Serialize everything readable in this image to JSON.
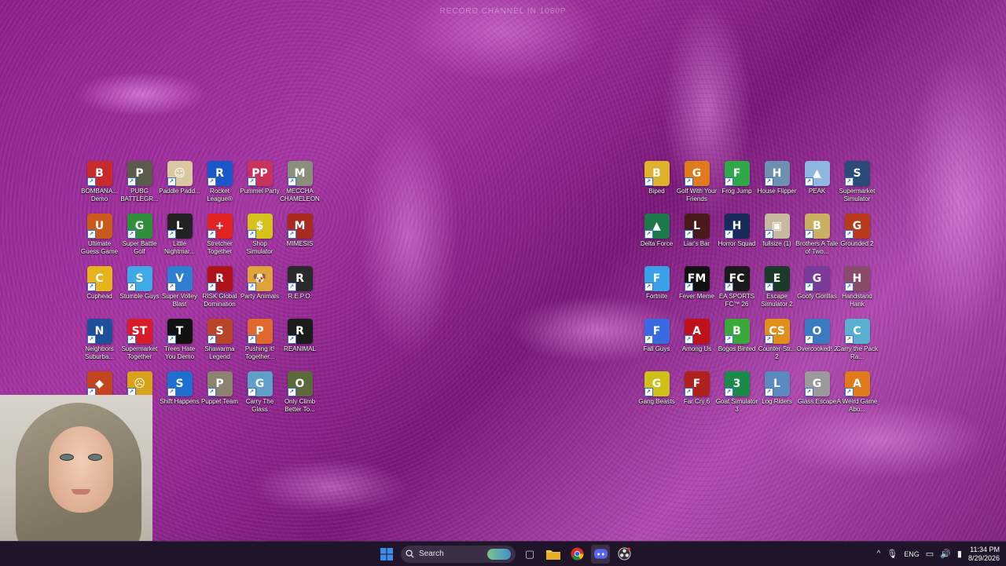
{
  "overlay_text": "RECORD CHANNEL IN 1080P",
  "left_icons": [
    {
      "label": "BOMBANA... Demo",
      "icon": "bombana-icon",
      "abbr": "B",
      "color": "#c92b2b"
    },
    {
      "label": "PUBG BATTLEGR...",
      "icon": "pubg-icon",
      "abbr": "P",
      "color": "#5b5b4a"
    },
    {
      "label": "Paddle Padd...",
      "icon": "paddle-paddle-icon",
      "abbr": "☺",
      "color": "#d9c8a0"
    },
    {
      "label": "Rocket League®",
      "icon": "rocket-league-icon",
      "abbr": "R",
      "color": "#1a58c9"
    },
    {
      "label": "Pummel Party",
      "icon": "pummel-party-icon",
      "abbr": "PP",
      "color": "#c9325a"
    },
    {
      "label": "MECCHA CHAMELEON",
      "icon": "meccha-chameleon-icon",
      "abbr": "M",
      "color": "#8a8f7c"
    },
    {
      "label": "Ultimate Guess Game",
      "icon": "ultimate-guess-game-icon",
      "abbr": "U",
      "color": "#c95a1b"
    },
    {
      "label": "Super Battle Golf",
      "icon": "super-battle-golf-icon",
      "abbr": "G",
      "color": "#2f8f3a"
    },
    {
      "label": "Little Nightmar...",
      "icon": "little-nightmares-icon",
      "abbr": "L",
      "color": "#222222"
    },
    {
      "label": "Stretcher Together",
      "icon": "stretcher-together-icon",
      "abbr": "+",
      "color": "#e02424"
    },
    {
      "label": "Shop Simulator",
      "icon": "shop-simulator-icon",
      "abbr": "$",
      "color": "#d6c21b"
    },
    {
      "label": "MIMESIS",
      "icon": "mimesis-icon",
      "abbr": "M",
      "color": "#a82a20"
    },
    {
      "label": "Cuphead",
      "icon": "cuphead-icon",
      "abbr": "C",
      "color": "#e8b21c"
    },
    {
      "label": "Stumble Guys",
      "icon": "stumble-guys-icon",
      "abbr": "S",
      "color": "#3fa9e8"
    },
    {
      "label": "Super Volley Blast",
      "icon": "super-volley-blast-icon",
      "abbr": "V",
      "color": "#2e7fd1"
    },
    {
      "label": "RISK Global Domination",
      "icon": "risk-icon",
      "abbr": "R",
      "color": "#b0121a"
    },
    {
      "label": "Party Animals",
      "icon": "party-animals-icon",
      "abbr": "🐶",
      "color": "#e0a33c"
    },
    {
      "label": "R.E.P.O.",
      "icon": "repo-icon",
      "abbr": "R",
      "color": "#2a2a2a"
    },
    {
      "label": "Neighbors Suburba...",
      "icon": "neighbors-icon",
      "abbr": "N",
      "color": "#1f4f9a"
    },
    {
      "label": "Supermarket Together",
      "icon": "supermarket-together-icon",
      "abbr": "ST",
      "color": "#d91c2c"
    },
    {
      "label": "Trees Hate You Demo",
      "icon": "trees-hate-you-icon",
      "abbr": "T",
      "color": "#111111"
    },
    {
      "label": "Shawarma Legend",
      "icon": "shawarma-legend-icon",
      "abbr": "S",
      "color": "#b8442a"
    },
    {
      "label": "Pushing it! Together...",
      "icon": "pushing-it-icon",
      "abbr": "P",
      "color": "#e0682f"
    },
    {
      "label": "REANIMAL",
      "icon": "reanimal-icon",
      "abbr": "R",
      "color": "#1b1b1b"
    },
    {
      "label": "",
      "icon": "game-icon",
      "abbr": "◆",
      "color": "#c2461d"
    },
    {
      "label": "",
      "icon": "game-icon",
      "abbr": "☹",
      "color": "#d8a21c"
    },
    {
      "label": "Shift Happens",
      "icon": "shift-happens-icon",
      "abbr": "S",
      "color": "#1f6fd0"
    },
    {
      "label": "Puppet Team",
      "icon": "puppet-team-icon",
      "abbr": "P",
      "color": "#8a8370"
    },
    {
      "label": "Carry The Glass",
      "icon": "carry-the-glass-icon",
      "abbr": "G",
      "color": "#5fa0c8"
    },
    {
      "label": "Only Climb Better To...",
      "icon": "only-climb-icon",
      "abbr": "O",
      "color": "#5c6a3a"
    }
  ],
  "right_icons": [
    {
      "label": "Biped",
      "icon": "biped-icon",
      "abbr": "B",
      "color": "#e0b12a"
    },
    {
      "label": "Golf With Your Friends",
      "icon": "golf-with-friends-icon",
      "abbr": "G",
      "color": "#e07b1c"
    },
    {
      "label": "Frog Jump",
      "icon": "frog-jump-icon",
      "abbr": "F",
      "color": "#2fa84a"
    },
    {
      "label": "House Flipper",
      "icon": "house-flipper-icon",
      "abbr": "H",
      "color": "#6d8fb0"
    },
    {
      "label": "PEAK",
      "icon": "peak-icon",
      "abbr": "▲",
      "color": "#8fb8e0"
    },
    {
      "label": "Supermarket Simulator",
      "icon": "supermarket-simulator-icon",
      "abbr": "S",
      "color": "#2a4a7a"
    },
    {
      "label": "Delta Force",
      "icon": "delta-force-icon",
      "abbr": "▲",
      "color": "#1c7a4a"
    },
    {
      "label": "Liar's Bar",
      "icon": "liars-bar-icon",
      "abbr": "L",
      "color": "#4a1a1a"
    },
    {
      "label": "Horror Squad",
      "icon": "horror-squad-icon",
      "abbr": "H",
      "color": "#1a2a5a"
    },
    {
      "label": "fullsize (1)",
      "icon": "image-file-icon",
      "abbr": "▣",
      "color": "#c8b8a0"
    },
    {
      "label": "Brothers A Tale of Two...",
      "icon": "brothers-icon",
      "abbr": "B",
      "color": "#c8b060"
    },
    {
      "label": "Grounded 2",
      "icon": "grounded-2-icon",
      "abbr": "G",
      "color": "#b83a1a"
    },
    {
      "label": "Fortnite",
      "icon": "fortnite-icon",
      "abbr": "F",
      "color": "#3aa0e8"
    },
    {
      "label": "Fever Meme",
      "icon": "fever-meme-icon",
      "abbr": "FM",
      "color": "#111111"
    },
    {
      "label": "EA SPORTS FC™ 26",
      "icon": "ea-sports-fc-icon",
      "abbr": "FC",
      "color": "#1a1a1a"
    },
    {
      "label": "Escape Simulator 2",
      "icon": "escape-simulator-icon",
      "abbr": "E",
      "color": "#1a3a2a"
    },
    {
      "label": "Goofy Gorillas",
      "icon": "goofy-gorillas-icon",
      "abbr": "G",
      "color": "#7a3a9a"
    },
    {
      "label": "Handstand Hank",
      "icon": "handstand-hank-icon",
      "abbr": "H",
      "color": "#8a4a6a"
    },
    {
      "label": "Fall Guys",
      "icon": "fall-guys-icon",
      "abbr": "F",
      "color": "#3a6ae0"
    },
    {
      "label": "Among Us",
      "icon": "among-us-icon",
      "abbr": "A",
      "color": "#c0101a"
    },
    {
      "label": "Bogos Binted",
      "icon": "bogos-binted-icon",
      "abbr": "B",
      "color": "#3aa83a"
    },
    {
      "label": "Counter-Str... 2",
      "icon": "counter-strike-icon",
      "abbr": "CS",
      "color": "#e0901a"
    },
    {
      "label": "Overcooked! 2",
      "icon": "overcooked-2-icon",
      "abbr": "O",
      "color": "#3a7ac0"
    },
    {
      "label": "Carry the Pack Ra...",
      "icon": "carry-the-pack-icon",
      "abbr": "C",
      "color": "#5ab0d0"
    },
    {
      "label": "Gang Beasts",
      "icon": "gang-beasts-icon",
      "abbr": "G",
      "color": "#d0c01a"
    },
    {
      "label": "Far Cry 6",
      "icon": "far-cry-6-icon",
      "abbr": "F",
      "color": "#b0201a"
    },
    {
      "label": "Goat Simulator 3",
      "icon": "goat-simulator-3-icon",
      "abbr": "3",
      "color": "#1a8a4a"
    },
    {
      "label": "Log Riders",
      "icon": "log-riders-icon",
      "abbr": "L",
      "color": "#5a8ac0"
    },
    {
      "label": "Glass Escape",
      "icon": "glass-escape-icon",
      "abbr": "G",
      "color": "#9a9a9a"
    },
    {
      "label": "A Weird Game Abo...",
      "icon": "weird-game-icon",
      "abbr": "A",
      "color": "#e07a1a"
    }
  ],
  "taskbar": {
    "search_label": "Search",
    "language": "ENG",
    "time": "11:34 PM",
    "date": "8/29/2026",
    "apps": [
      {
        "name": "task-view-icon",
        "glyph": "▢"
      },
      {
        "name": "file-explorer-icon",
        "glyph": "📁"
      },
      {
        "name": "chrome-icon",
        "glyph": "◉"
      },
      {
        "name": "discord-icon",
        "glyph": "☺"
      },
      {
        "name": "obs-icon",
        "glyph": "◎"
      }
    ]
  },
  "colors": {
    "taskbar_bg": "#20142b",
    "wallpaper": "#a536a3",
    "windows_blue": "#3b8ee8"
  }
}
